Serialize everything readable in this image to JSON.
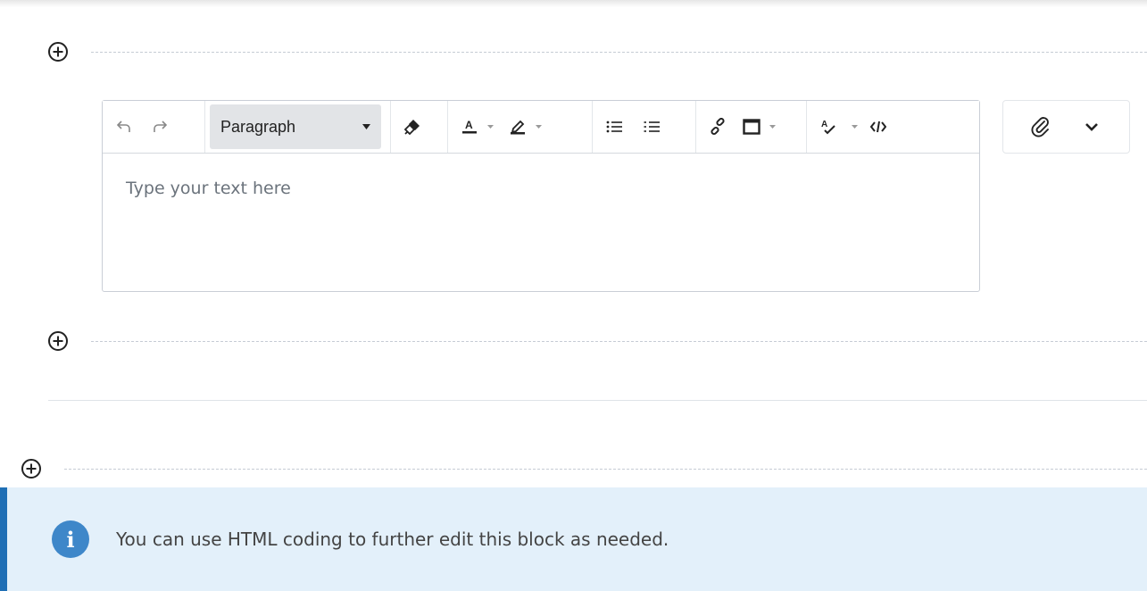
{
  "editor": {
    "block_format": "Paragraph",
    "placeholder": "Type your text here"
  },
  "toolbar_icons": [
    "undo-icon",
    "redo-icon",
    "format-painter-icon",
    "text-color-icon",
    "highlight-icon",
    "bullet-list-icon",
    "numbered-list-icon",
    "link-icon",
    "insert-box-icon",
    "spellcheck-icon",
    "code-view-icon"
  ],
  "side_actions": [
    "paperclip-icon",
    "chevron-down-icon"
  ],
  "info_banner": {
    "text": "You can use HTML coding to further edit this block as needed.",
    "icon_glyph": "i"
  },
  "colors": {
    "accent": "#1f6fb5",
    "banner_bg": "#e3f0fa",
    "info_icon": "#3e87c9"
  }
}
